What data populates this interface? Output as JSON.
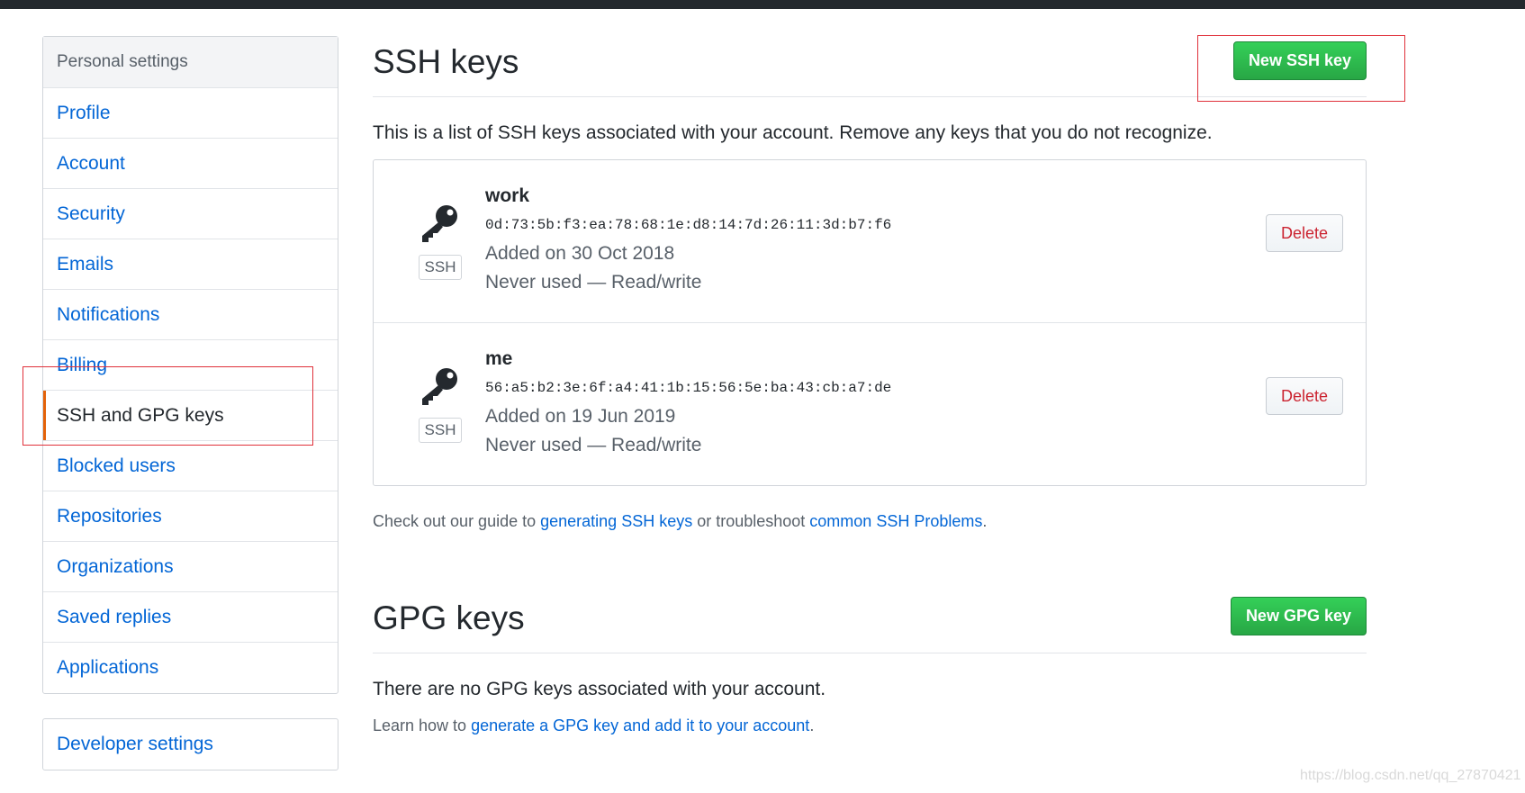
{
  "sidebar": {
    "heading": "Personal settings",
    "items": [
      {
        "label": "Profile"
      },
      {
        "label": "Account"
      },
      {
        "label": "Security"
      },
      {
        "label": "Emails"
      },
      {
        "label": "Notifications"
      },
      {
        "label": "Billing"
      },
      {
        "label": "SSH and GPG keys",
        "selected": true
      },
      {
        "label": "Blocked users"
      },
      {
        "label": "Repositories"
      },
      {
        "label": "Organizations"
      },
      {
        "label": "Saved replies"
      },
      {
        "label": "Applications"
      }
    ],
    "developer_settings": "Developer settings"
  },
  "ssh": {
    "title": "SSH keys",
    "new_button": "New SSH key",
    "description": "This is a list of SSH keys associated with your account. Remove any keys that you do not recognize.",
    "keys": [
      {
        "title": "work",
        "fingerprint": "0d:73:5b:f3:ea:78:68:1e:d8:14:7d:26:11:3d:b7:f6",
        "added": "Added on 30 Oct 2018",
        "usage": "Never used — Read/write",
        "badge": "SSH",
        "delete": "Delete"
      },
      {
        "title": "me",
        "fingerprint": "56:a5:b2:3e:6f:a4:41:1b:15:56:5e:ba:43:cb:a7:de",
        "added": "Added on 19 Jun 2019",
        "usage": "Never used — Read/write",
        "badge": "SSH",
        "delete": "Delete"
      }
    ],
    "help": {
      "prefix": "Check out our guide to ",
      "link1": "generating SSH keys",
      "middle": " or troubleshoot ",
      "link2": "common SSH Problems",
      "suffix": "."
    }
  },
  "gpg": {
    "title": "GPG keys",
    "new_button": "New GPG key",
    "empty": "There are no GPG keys associated with your account.",
    "hint": {
      "prefix": "Learn how to ",
      "link": "generate a GPG key and add it to your account",
      "suffix": "."
    }
  },
  "watermark": "https://blog.csdn.net/qq_27870421",
  "colors": {
    "accent": "#e36209",
    "link": "#0366d6",
    "primary_green": "#28a745",
    "danger": "#cb2431",
    "annotation_red": "#e0313a"
  }
}
